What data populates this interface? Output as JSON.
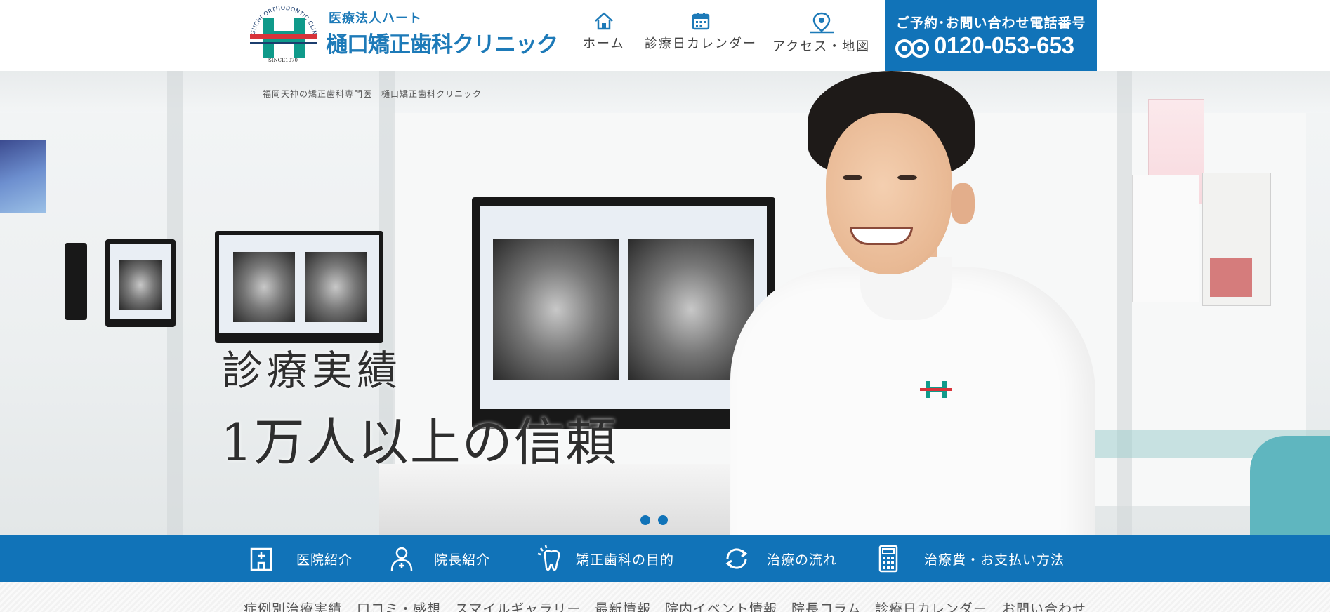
{
  "header": {
    "logo": {
      "arc_text": "HIGUCHI ORTHODONTIC CLINIC",
      "since": "SINCE1970",
      "sub": "医療法人ハート",
      "main": "樋口矯正歯科クリニック",
      "brand_blue": "#1d7ab8",
      "brand_green": "#0f9a8a",
      "brand_red": "#d8333a"
    },
    "nav": [
      {
        "label": "ホーム",
        "icon": "home-icon"
      },
      {
        "label": "診療日カレンダー",
        "icon": "calendar-icon"
      },
      {
        "label": "アクセス・地図",
        "icon": "map-pin-icon"
      }
    ],
    "phone": {
      "label": "ご予約･お問い合わせ電話番号",
      "number": "0120-053-653",
      "icon": "freedial-icon",
      "bg": "#1173b8"
    }
  },
  "hero": {
    "caption": "福岡天神の矯正歯科専門医　樋口矯正歯科クリニック",
    "line1": "診療実績",
    "line2": "1万人以上の信頼",
    "slides": 2
  },
  "menubar": {
    "bg": "#1173b8",
    "items": [
      {
        "label": "医院紹介",
        "icon": "clinic-building-icon"
      },
      {
        "label": "院長紹介",
        "icon": "doctor-icon"
      },
      {
        "label": "矯正歯科の目的",
        "icon": "tooth-icon"
      },
      {
        "label": "治療の流れ",
        "icon": "cycle-arrows-icon"
      },
      {
        "label": "治療費・お支払い方法",
        "icon": "calculator-icon"
      }
    ]
  },
  "sublinks": [
    "症例別治療実績",
    "口コミ・感想",
    "スマイルギャラリー",
    "最新情報",
    "院内イベント情報",
    "院長コラム",
    "診療日カレンダー",
    "お問い合わせ"
  ]
}
